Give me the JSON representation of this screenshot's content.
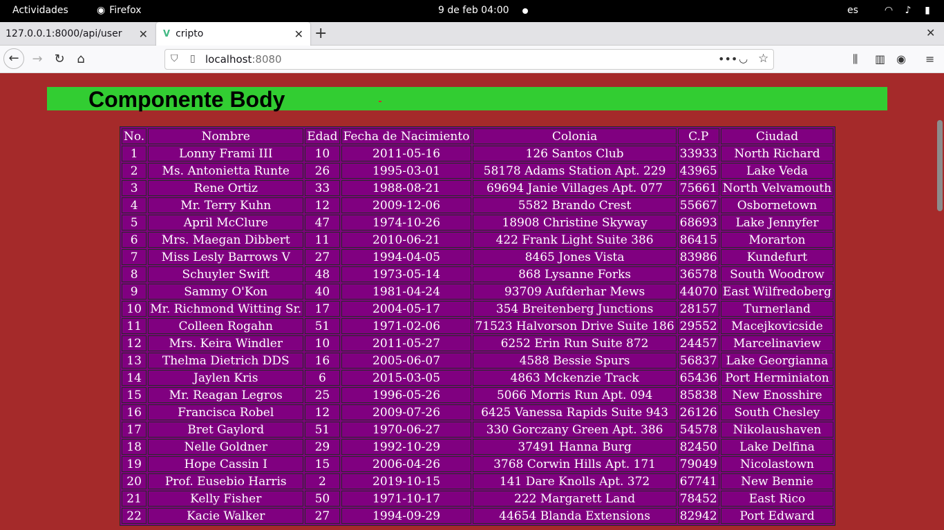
{
  "system_bar": {
    "activities": "Actividades",
    "app_name": "Firefox",
    "datetime": "9 de feb  04:00",
    "language": "es"
  },
  "browser": {
    "tabs": [
      {
        "label": "127.0.0.1:8000/api/user"
      },
      {
        "label": "cripto"
      }
    ],
    "url_host": "localhost",
    "url_port": ":8080"
  },
  "page": {
    "banner_title": "Componente Body",
    "banner_color": "#32cd32",
    "background_color": "#a52a2a",
    "table_color": "#800080"
  },
  "table": {
    "headers": [
      "No.",
      "Nombre",
      "Edad",
      "Fecha de Nacimiento",
      "Colonia",
      "C.P",
      "Ciudad"
    ],
    "rows": [
      [
        "1",
        "Lonny Frami III",
        "10",
        "2011-05-16",
        "126 Santos Club",
        "33933",
        "North Richard"
      ],
      [
        "2",
        "Ms. Antonietta Runte",
        "26",
        "1995-03-01",
        "58178 Adams Station Apt. 229",
        "43965",
        "Lake Veda"
      ],
      [
        "3",
        "Rene Ortiz",
        "33",
        "1988-08-21",
        "69694 Janie Villages Apt. 077",
        "75661",
        "North Velvamouth"
      ],
      [
        "4",
        "Mr. Terry Kuhn",
        "12",
        "2009-12-06",
        "5582 Brando Crest",
        "55667",
        "Osbornetown"
      ],
      [
        "5",
        "April McClure",
        "47",
        "1974-10-26",
        "18908 Christine Skyway",
        "68693",
        "Lake Jennyfer"
      ],
      [
        "6",
        "Mrs. Maegan Dibbert",
        "11",
        "2010-06-21",
        "422 Frank Light Suite 386",
        "86415",
        "Morarton"
      ],
      [
        "7",
        "Miss Lesly Barrows V",
        "27",
        "1994-04-05",
        "8465 Jones Vista",
        "83986",
        "Kundefurt"
      ],
      [
        "8",
        "Schuyler Swift",
        "48",
        "1973-05-14",
        "868 Lysanne Forks",
        "36578",
        "South Woodrow"
      ],
      [
        "9",
        "Sammy O'Kon",
        "40",
        "1981-04-24",
        "93709 Aufderhar Mews",
        "44070",
        "East Wilfredoberg"
      ],
      [
        "10",
        "Mr. Richmond Witting Sr.",
        "17",
        "2004-05-17",
        "354 Breitenberg Junctions",
        "28157",
        "Turnerland"
      ],
      [
        "11",
        "Colleen Rogahn",
        "51",
        "1971-02-06",
        "71523 Halvorson Drive Suite 186",
        "29552",
        "Macejkovicside"
      ],
      [
        "12",
        "Mrs. Keira Windler",
        "10",
        "2011-05-27",
        "6252 Erin Run Suite 872",
        "24457",
        "Marcelinaview"
      ],
      [
        "13",
        "Thelma Dietrich DDS",
        "16",
        "2005-06-07",
        "4588 Bessie Spurs",
        "56837",
        "Lake Georgianna"
      ],
      [
        "14",
        "Jaylen Kris",
        "6",
        "2015-03-05",
        "4863 Mckenzie Track",
        "65436",
        "Port Herminiaton"
      ],
      [
        "15",
        "Mr. Reagan Legros",
        "25",
        "1996-05-26",
        "5066 Morris Run Apt. 094",
        "85838",
        "New Enosshire"
      ],
      [
        "16",
        "Francisca Robel",
        "12",
        "2009-07-26",
        "6425 Vanessa Rapids Suite 943",
        "26126",
        "South Chesley"
      ],
      [
        "17",
        "Bret Gaylord",
        "51",
        "1970-06-27",
        "330 Gorczany Green Apt. 386",
        "54578",
        "Nikolaushaven"
      ],
      [
        "18",
        "Nelle Goldner",
        "29",
        "1992-10-29",
        "37491 Hanna Burg",
        "82450",
        "Lake Delfina"
      ],
      [
        "19",
        "Hope Cassin I",
        "15",
        "2006-04-26",
        "3768 Corwin Hills Apt. 171",
        "79049",
        "Nicolastown"
      ],
      [
        "20",
        "Prof. Eusebio Harris",
        "2",
        "2019-10-15",
        "141 Dare Knolls Apt. 372",
        "67741",
        "New Bennie"
      ],
      [
        "21",
        "Kelly Fisher",
        "50",
        "1971-10-17",
        "222 Margarett Land",
        "78452",
        "East Rico"
      ],
      [
        "22",
        "Kacie Walker",
        "27",
        "1994-09-29",
        "44654 Blanda Extensions",
        "82942",
        "Port Edward"
      ]
    ]
  }
}
